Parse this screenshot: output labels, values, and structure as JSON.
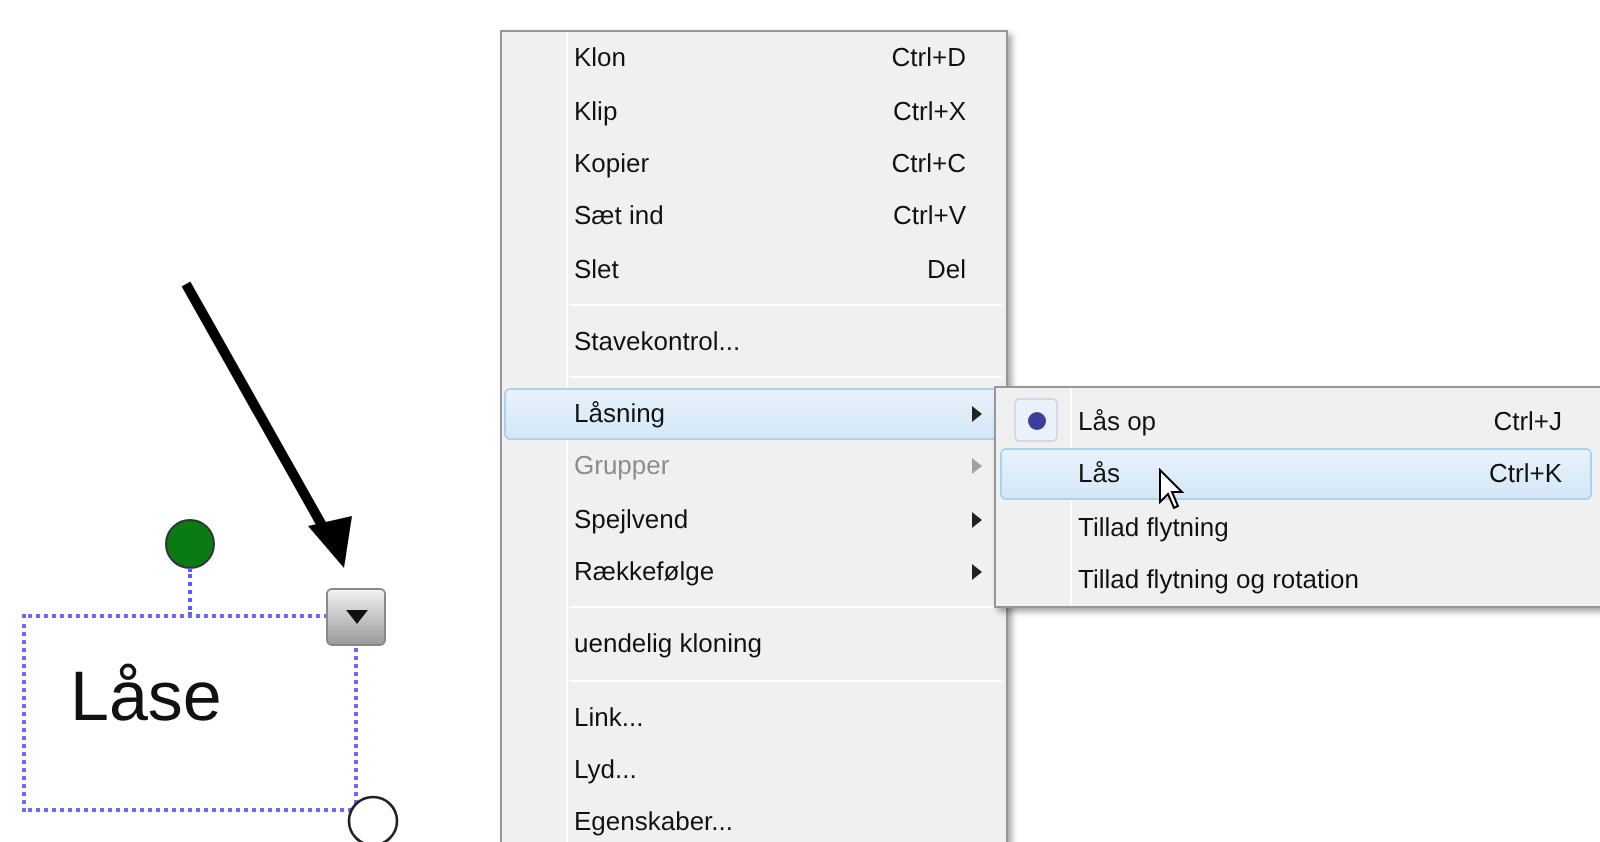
{
  "canvas": {
    "text_box": {
      "text": "Låse"
    }
  },
  "context_menu": {
    "items": [
      {
        "kind": "item",
        "label": "Klon",
        "shortcut": "Ctrl+D",
        "disabled": false,
        "submenu": false,
        "selected": false
      },
      {
        "kind": "item",
        "label": "Klip",
        "shortcut": "Ctrl+X",
        "disabled": false,
        "submenu": false,
        "selected": false
      },
      {
        "kind": "item",
        "label": "Kopier",
        "shortcut": "Ctrl+C",
        "disabled": false,
        "submenu": false,
        "selected": false
      },
      {
        "kind": "item",
        "label": "Sæt ind",
        "shortcut": "Ctrl+V",
        "disabled": false,
        "submenu": false,
        "selected": false
      },
      {
        "kind": "item",
        "label": "Slet",
        "shortcut": "Del",
        "disabled": false,
        "submenu": false,
        "selected": false
      },
      {
        "kind": "separator"
      },
      {
        "kind": "item",
        "label": "Stavekontrol...",
        "disabled": false,
        "submenu": false,
        "selected": false
      },
      {
        "kind": "separator"
      },
      {
        "kind": "item",
        "label": "Låsning",
        "disabled": false,
        "submenu": true,
        "selected": true
      },
      {
        "kind": "item",
        "label": "Grupper",
        "disabled": true,
        "submenu": true,
        "selected": false
      },
      {
        "kind": "item",
        "label": "Spejlvend",
        "disabled": false,
        "submenu": true,
        "selected": false
      },
      {
        "kind": "item",
        "label": "Rækkefølge",
        "disabled": false,
        "submenu": true,
        "selected": false
      },
      {
        "kind": "separator"
      },
      {
        "kind": "item",
        "label": "uendelig kloning",
        "disabled": false,
        "submenu": false,
        "selected": false
      },
      {
        "kind": "separator"
      },
      {
        "kind": "item",
        "label": "Link...",
        "disabled": false,
        "submenu": false,
        "selected": false
      },
      {
        "kind": "item",
        "label": "Lyd...",
        "disabled": false,
        "submenu": false,
        "selected": false
      },
      {
        "kind": "item",
        "label": "Egenskaber...",
        "disabled": false,
        "submenu": false,
        "selected": false
      }
    ]
  },
  "submenu": {
    "items": [
      {
        "label": "Lås op",
        "shortcut": "Ctrl+J",
        "checked": true,
        "selected": false
      },
      {
        "label": "Lås",
        "shortcut": "Ctrl+K",
        "checked": false,
        "selected": true
      },
      {
        "label": "Tillad flytning",
        "checked": false,
        "selected": false
      },
      {
        "label": "Tillad flytning og rotation",
        "checked": false,
        "selected": false
      }
    ]
  }
}
